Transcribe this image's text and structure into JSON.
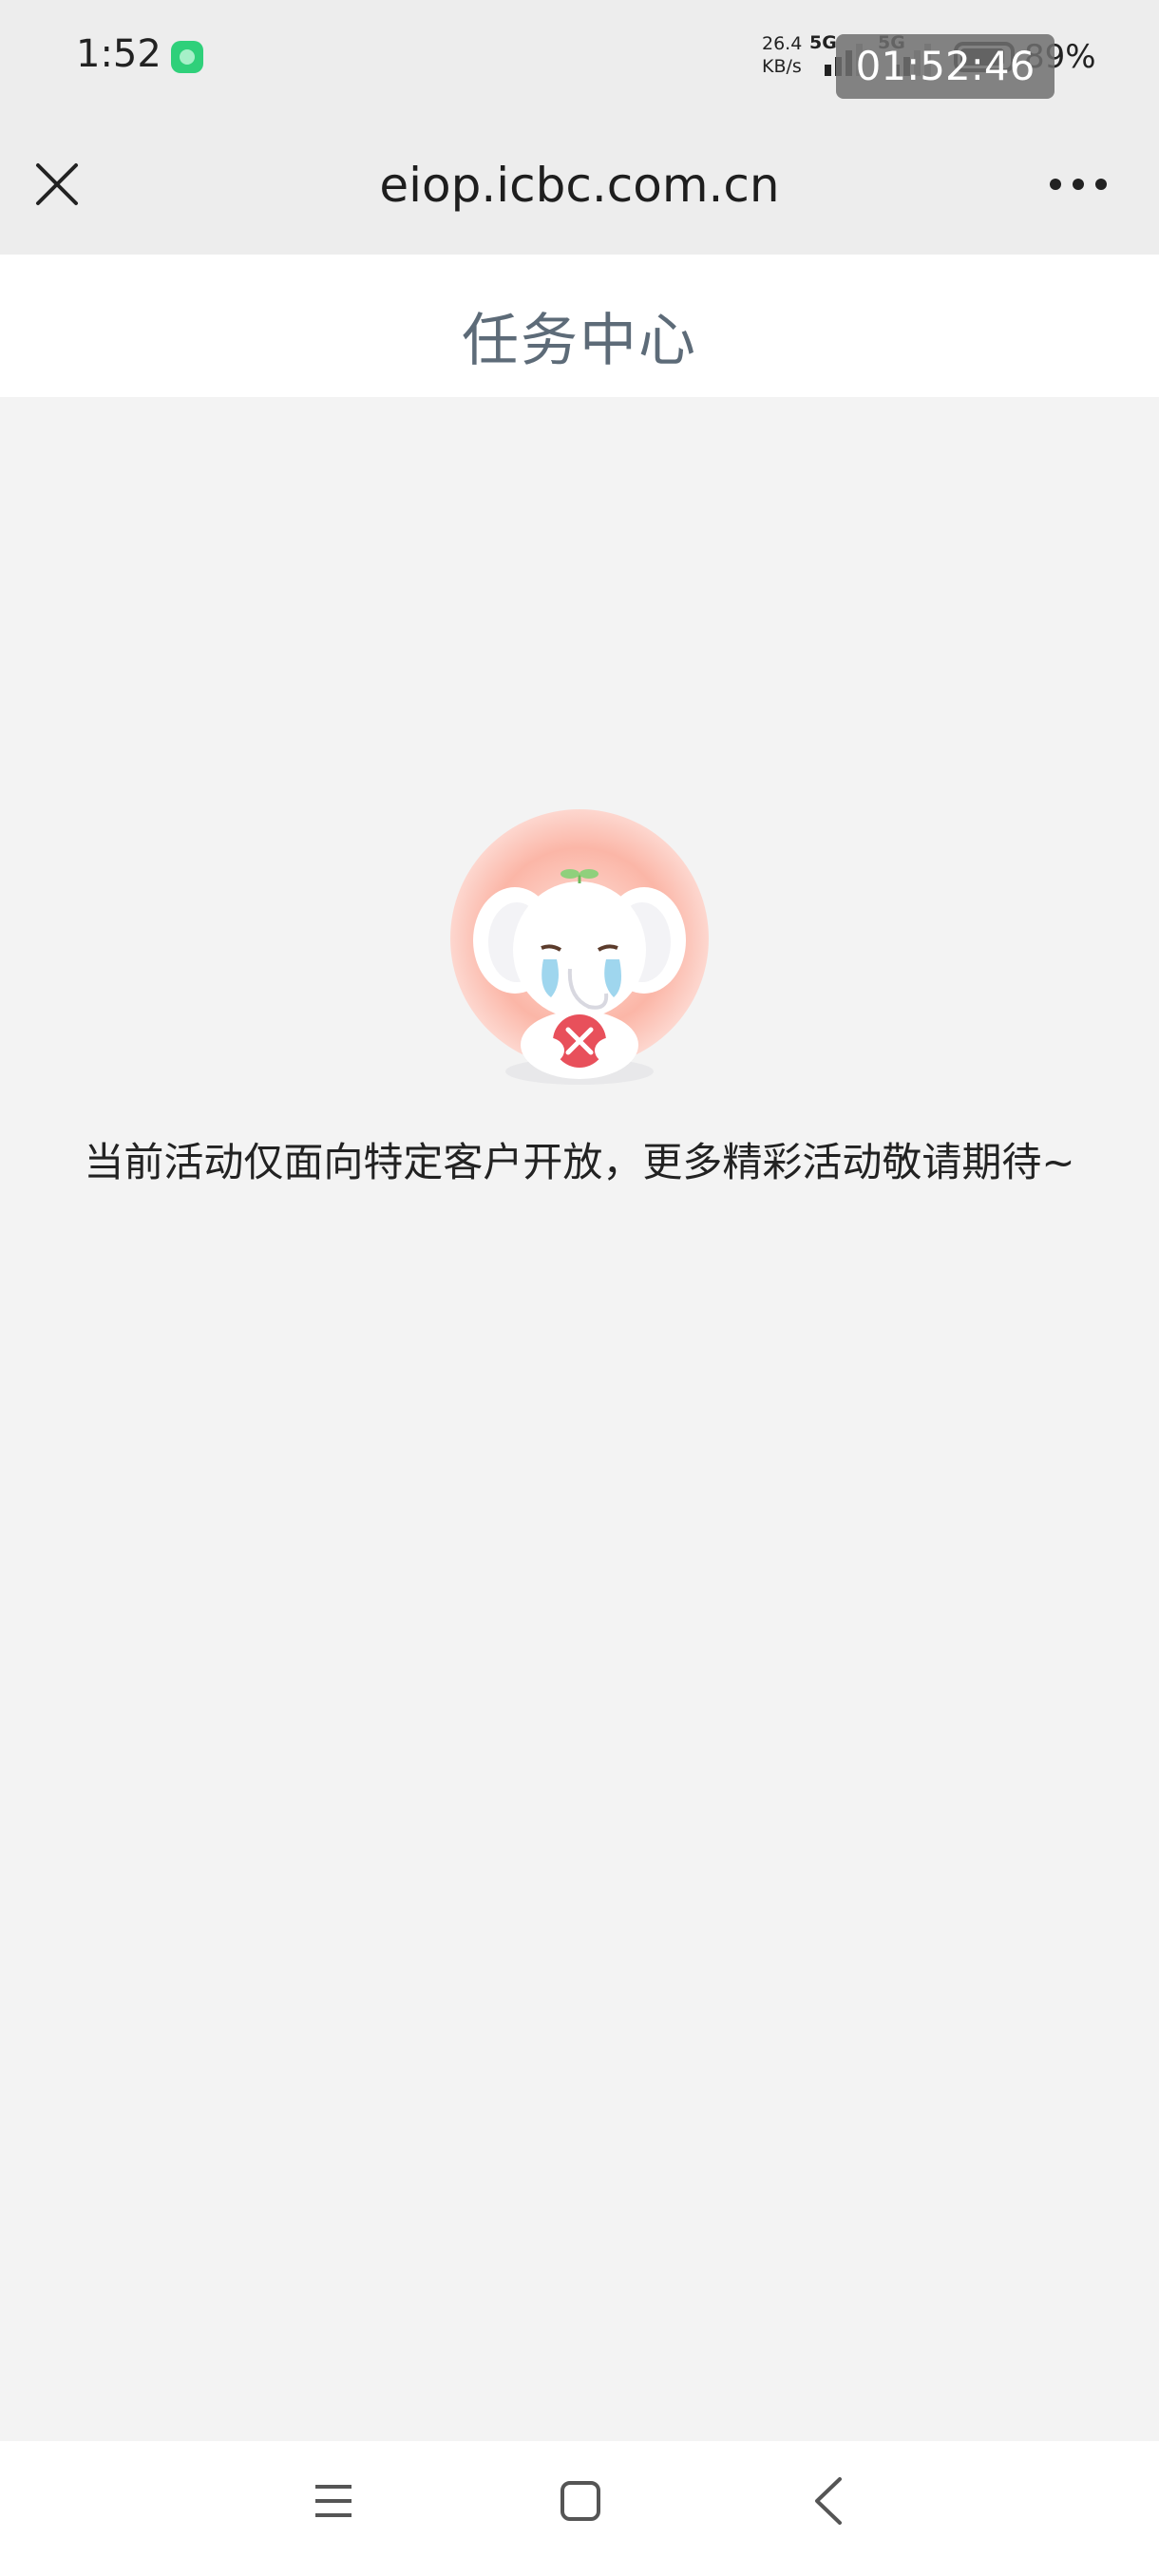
{
  "status_bar": {
    "time": "1:52",
    "net_speed_value": "26.4",
    "net_speed_unit": "KB/s",
    "network_1": "5G",
    "network_2": "5G",
    "battery_percent": "89%",
    "recording_timer": "01:52:46"
  },
  "browser": {
    "url": "eiop.icbc.com.cn",
    "close_icon": "close-icon",
    "more_icon": "more-dots-icon"
  },
  "page": {
    "title": "任务中心"
  },
  "empty_state": {
    "illustration": "crying-elephant-illustration",
    "message": "当前活动仅面向特定客户开放，更多精彩活动敬请期待~"
  },
  "nav_bar": {
    "menu_icon": "menu-icon",
    "home_icon": "home-icon",
    "back_icon": "back-icon"
  }
}
